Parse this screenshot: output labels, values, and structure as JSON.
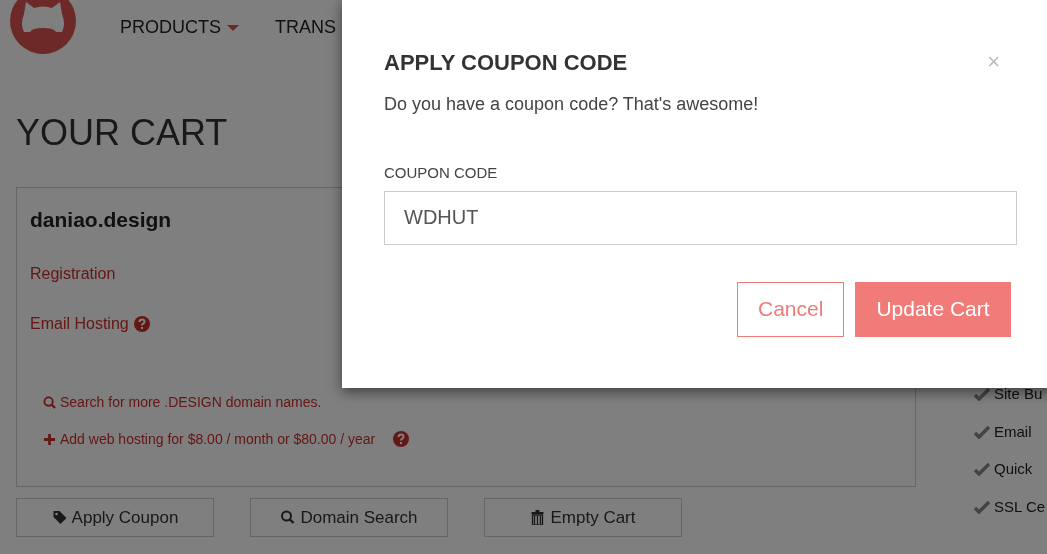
{
  "nav": {
    "items": [
      {
        "label": "PRODUCTS",
        "dropdown": true
      },
      {
        "label": "TRANS",
        "dropdown": false
      }
    ]
  },
  "page_title": "YOUR CART",
  "cart": {
    "domain": "daniao.design",
    "lines": [
      {
        "label": "Registration",
        "help": false
      },
      {
        "label": "Email Hosting",
        "help": true
      }
    ],
    "links": [
      {
        "kind": "search",
        "label": "Search for more .DESIGN domain names.",
        "help": false
      },
      {
        "kind": "add",
        "label": "Add web hosting for $8.00 / month or $80.00 / year",
        "help": true
      }
    ]
  },
  "actions": [
    {
      "kind": "tag",
      "label": "Apply Coupon"
    },
    {
      "kind": "search",
      "label": "Domain Search"
    },
    {
      "kind": "trash",
      "label": "Empty Cart"
    }
  ],
  "features": [
    "Site Bu",
    "Email",
    "Quick",
    "SSL Ce"
  ],
  "modal": {
    "title": "APPLY COUPON CODE",
    "close": "×",
    "message": "Do you have a coupon code? That's awesome!",
    "field": {
      "label": "COUPON CODE",
      "value": "WDHUT"
    },
    "buttons": [
      {
        "kind": "secondary",
        "label": "Cancel"
      },
      {
        "kind": "primary",
        "label": "Update Cart"
      }
    ]
  }
}
